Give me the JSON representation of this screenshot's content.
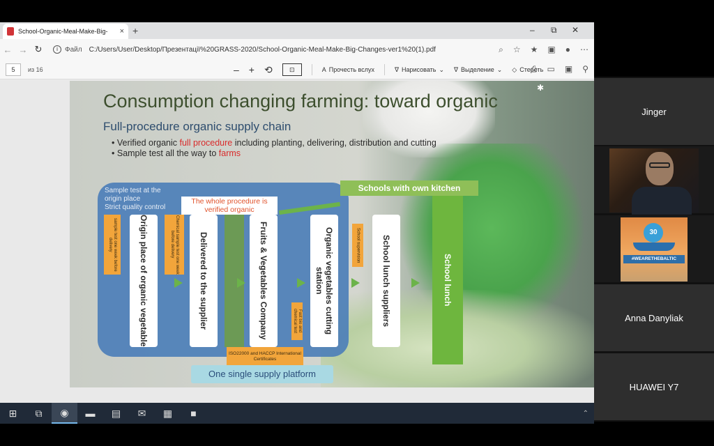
{
  "browser": {
    "tab_title": "School-Organic-Meal-Make-Big-",
    "tab_close": "×",
    "new_tab": "+",
    "window_controls": [
      "–",
      "⧉",
      "✕"
    ],
    "address_label": "Файл",
    "url": "C:/Users/User/Desktop/Презентації%20GRASS-2020/School-Organic-Meal-Make-Big-Changes-ver1%20(1).pdf"
  },
  "pdf_toolbar": {
    "page_number": "5",
    "page_of": "из 16",
    "zoom_out": "–",
    "zoom_in": "+",
    "read_aloud": "Прочесть вслух",
    "draw": "Нарисовать",
    "highlight": "Выделение",
    "erase": "Стереть"
  },
  "slide": {
    "title": "Consumption changing farming: toward organic",
    "subtitle": "Full-procedure organic supply chain",
    "bullet1_prefix": "Verified organic ",
    "bullet1_red": "full procedure",
    "bullet1_suffix": " including planting, delivering, distribution and cutting",
    "bullet2_prefix": "Sample test all the way to ",
    "bullet2_red": "farms",
    "sample_note": [
      "Sample test at the",
      "origin place",
      "Strict quality control"
    ],
    "whole_procedure": "The whole procedure is verified organic",
    "schools_own_kitchen": "Schools with own kitchen",
    "columns": [
      "Origin place of organic vegetable",
      "Delivered to the supplier",
      "Fruits & Vegetables Company",
      "Organic vegetables cutting station",
      "School lunch suppliers"
    ],
    "orange_notes": [
      "sample test one week before delivery",
      "Chemical sample test one week before delivery",
      "Fast bio and chemical test",
      "School supervision"
    ],
    "iso_cert": "ISO22000 and HACCP International Certificates",
    "school_lunch": "School lunch",
    "one_platform": "One single supply platform"
  },
  "participants": [
    {
      "name": "Jinger",
      "video": false
    },
    {
      "name": "",
      "video": true
    },
    {
      "name": "",
      "video": true,
      "logo_text": "#WEARETHEBALTIC",
      "badge": "30"
    },
    {
      "name": "Anna Danyliak",
      "video": false
    },
    {
      "name": "HUAWEI Y7",
      "video": false
    }
  ],
  "taskbar": {
    "icons": [
      "windows-start-icon",
      "task-view-icon",
      "edge-icon",
      "file-explorer-icon",
      "store-icon",
      "mail-icon",
      "terminal-icon",
      "app-icon"
    ]
  },
  "colors": {
    "flow_blue": "#4d7fb8",
    "accent_green": "#6eb63e",
    "accent_orange": "#f2a53b",
    "title_green": "#3d4f2e",
    "highlight_red": "#d92b2b"
  }
}
